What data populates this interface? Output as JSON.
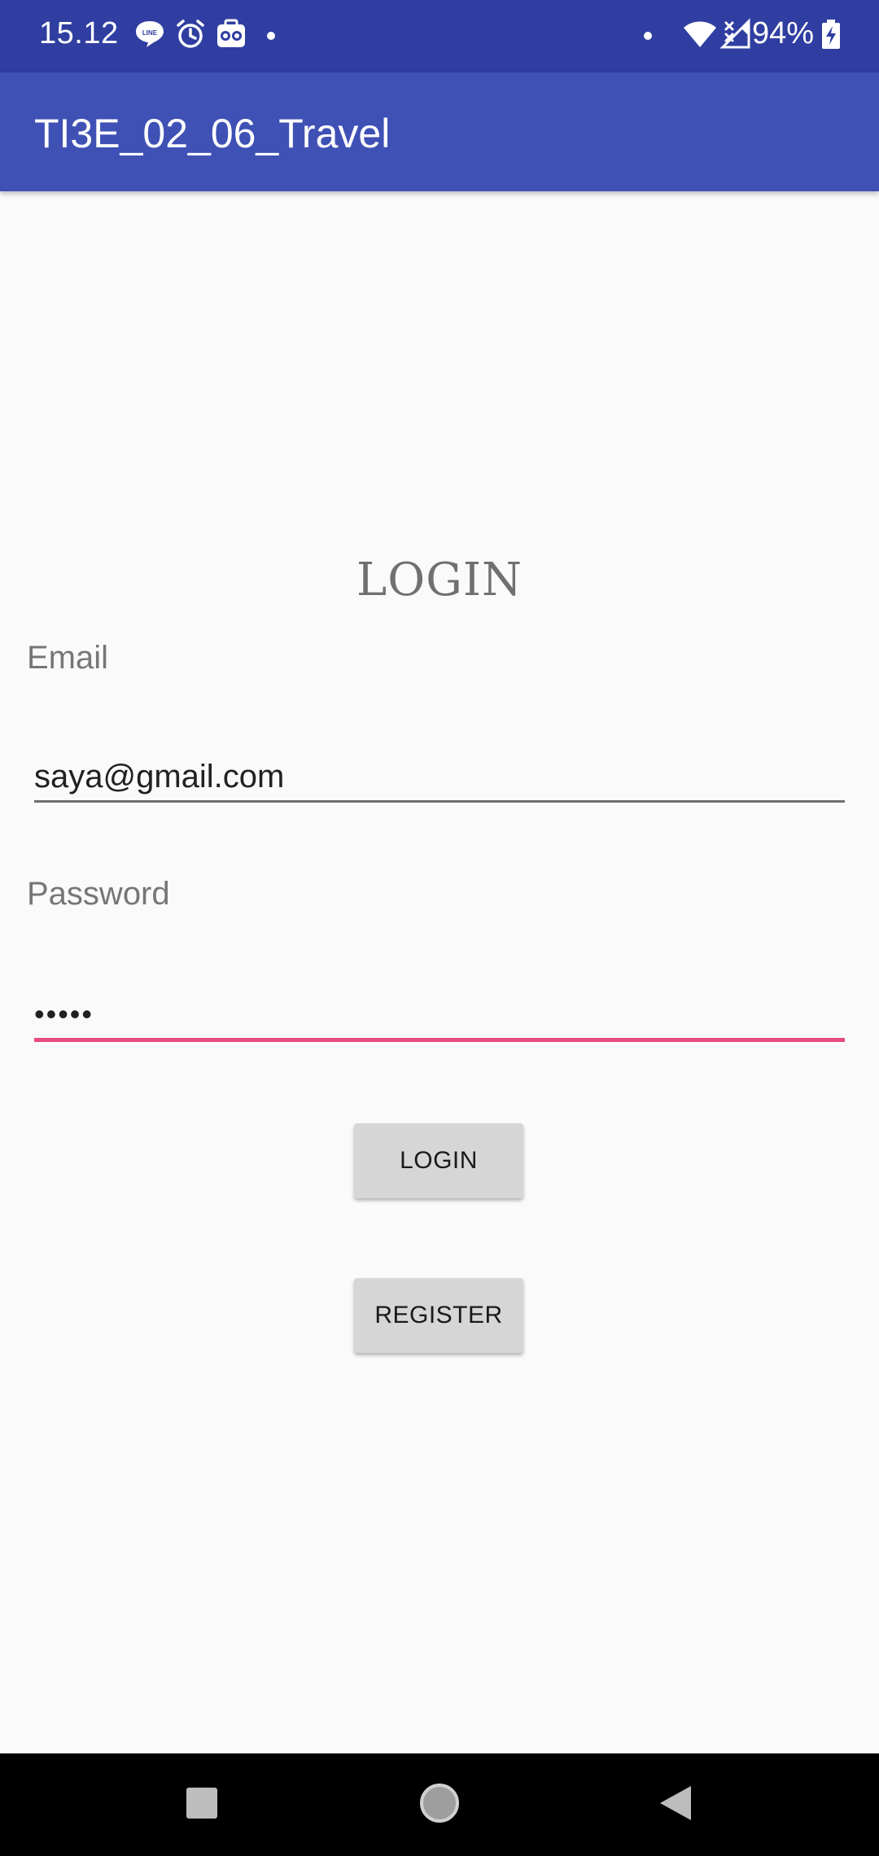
{
  "status_bar": {
    "time": "15.12",
    "battery": "94%",
    "icons": [
      "line-icon",
      "alarm-icon",
      "tripadvisor-icon",
      "dot-icon",
      "dot-icon",
      "wifi-icon",
      "signal-off-icon",
      "battery-charging-icon"
    ]
  },
  "toolbar": {
    "title": "TI3E_02_06_Travel"
  },
  "form": {
    "heading": "LOGIN",
    "email_label": "Email",
    "email_value": "saya@gmail.com",
    "password_label": "Password",
    "password_value": "•••••",
    "login_label": "LOGIN",
    "register_label": "REGISTER"
  },
  "navigation": {
    "buttons": [
      "recents-icon",
      "home-icon",
      "back-icon"
    ]
  },
  "colors": {
    "status_bar": "#2f3ea0",
    "toolbar": "#3f51b5",
    "focused_underline": "#e84a86",
    "button_bg": "#d6d6d6"
  }
}
